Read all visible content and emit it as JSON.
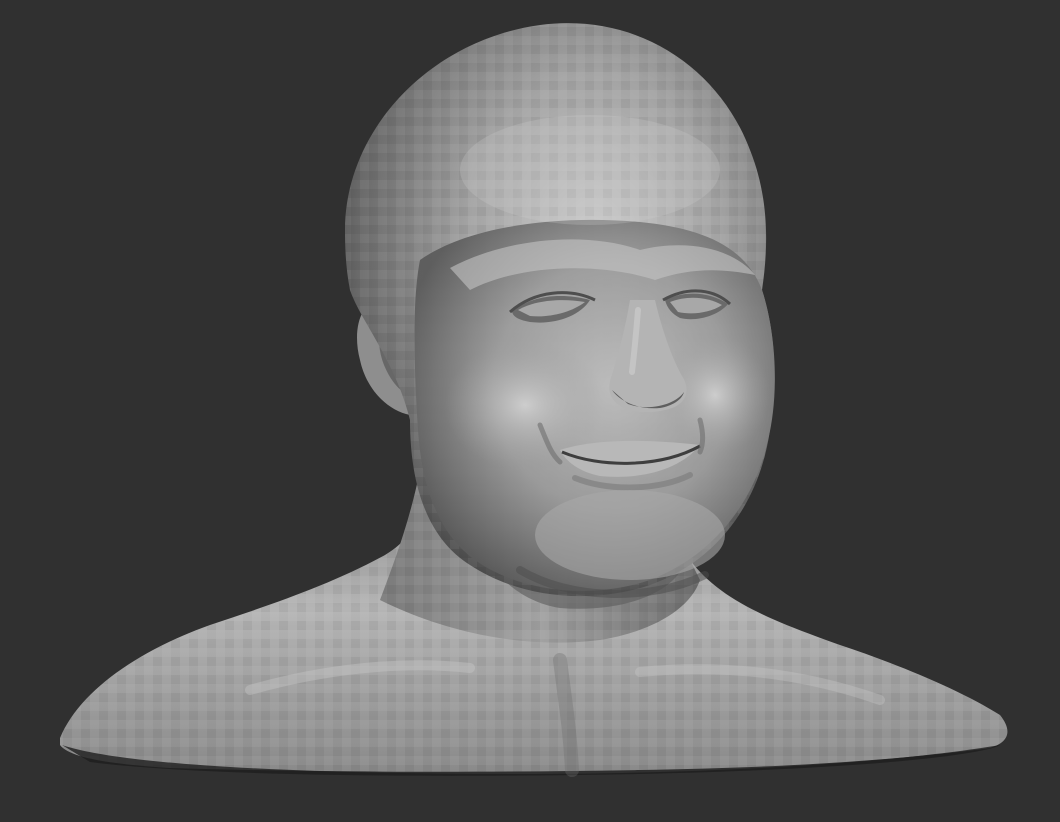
{
  "scene": {
    "background_color": "#303030",
    "subject": "sculpted-bust",
    "material_color": "#9a9a9a"
  }
}
